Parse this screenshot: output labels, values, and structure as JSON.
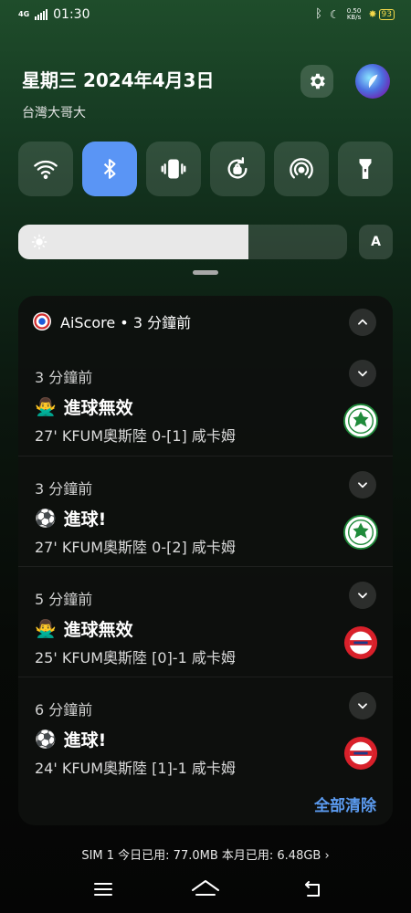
{
  "status_bar": {
    "network": "4G",
    "time": "01:30",
    "net_speed": "0.50",
    "net_speed_unit": "KB/s",
    "battery": "93"
  },
  "header": {
    "date": "星期三 2024年4月3日",
    "carrier": "台灣大哥大"
  },
  "quick_tiles": [
    {
      "name": "wifi",
      "icon": "wifi-icon",
      "active": false
    },
    {
      "name": "bluetooth",
      "icon": "bluetooth-icon",
      "active": true
    },
    {
      "name": "vibrate",
      "icon": "vibrate-icon",
      "active": false
    },
    {
      "name": "rotation-lock",
      "icon": "rotation-lock-icon",
      "active": false
    },
    {
      "name": "hotspot",
      "icon": "hotspot-icon",
      "active": false
    },
    {
      "name": "flashlight",
      "icon": "flashlight-icon",
      "active": false
    }
  ],
  "brightness": {
    "level_percent": 70,
    "auto_label": "A"
  },
  "notification_group": {
    "app_name": "AiScore",
    "separator": " • ",
    "app_time": "3 分鐘前",
    "items": [
      {
        "time": "3 分鐘前",
        "emoji": "🙅‍♂️",
        "title": "進球無效",
        "body": "27' KFUM奧斯陸 0-[1] 咸卡姆",
        "team_logo": "hamkam-logo"
      },
      {
        "time": "3 分鐘前",
        "emoji": "⚽",
        "title": "進球!",
        "body": "27' KFUM奧斯陸 0-[2] 咸卡姆",
        "team_logo": "hamkam-logo"
      },
      {
        "time": "5 分鐘前",
        "emoji": "🙅‍♂️",
        "title": "進球無效",
        "body": "25' KFUM奧斯陸 [0]-1 咸卡姆",
        "team_logo": "kfum-logo"
      },
      {
        "time": "6 分鐘前",
        "emoji": "⚽",
        "title": "進球!",
        "body": "24' KFUM奧斯陸 [1]-1 咸卡姆",
        "team_logo": "kfum-logo"
      }
    ],
    "clear_all_label": "全部清除"
  },
  "data_usage": "SIM 1 今日已用: 77.0MB 本月已用: 6.48GB ›",
  "colors": {
    "accent": "#5b9bf0",
    "tile_active": "#5a95f5",
    "kfum_red": "#d8202a",
    "hamkam_green": "#1f8a3a"
  }
}
